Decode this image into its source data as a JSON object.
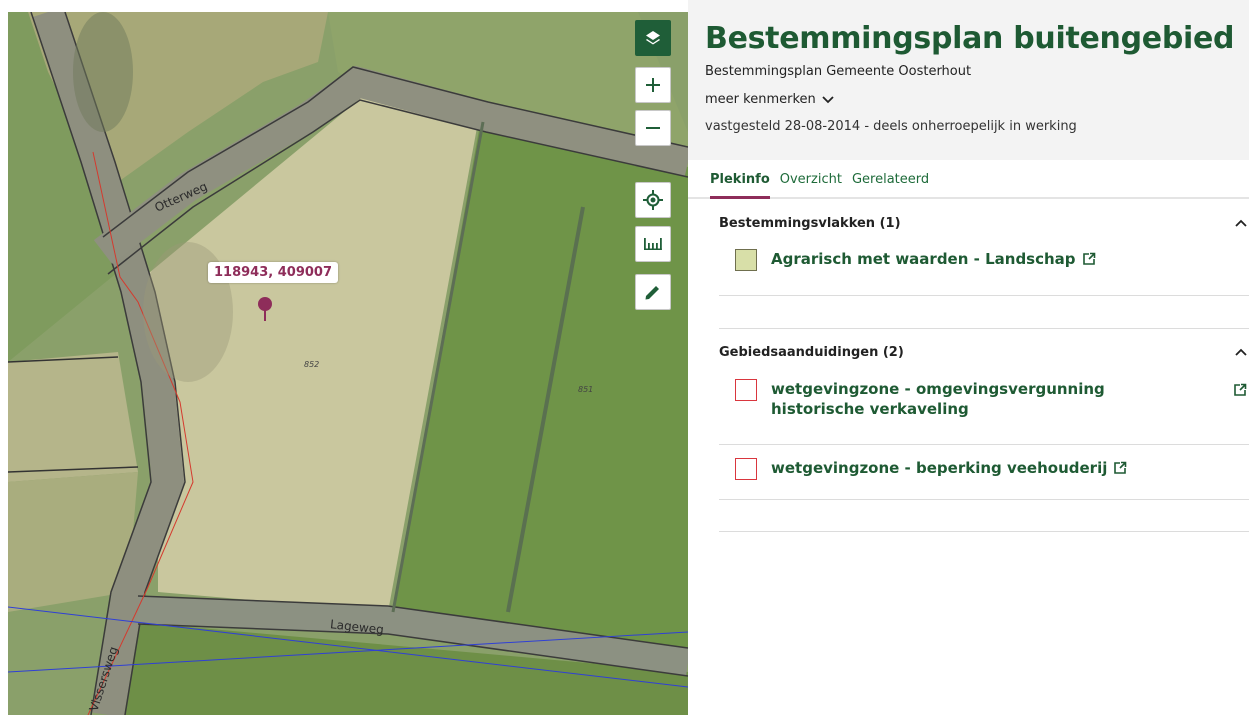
{
  "map": {
    "coordinate": "118943, 409007",
    "streets": {
      "otterweg": "Otterweg",
      "lageweg": "Lageweg",
      "vissersweg": "Vissersweg"
    },
    "parcels": {
      "left": "852",
      "right": "851"
    },
    "controls": [
      "layers-icon",
      "zoom-in-icon",
      "zoom-out-icon",
      "locate-icon",
      "measure-icon",
      "draw-icon"
    ],
    "accent": "#1f5e38"
  },
  "panel": {
    "title": "Bestemmingsplan buitengebied",
    "subtitle": "Bestemmingsplan  Gemeente Oosterhout",
    "more_label": "meer kenmerken",
    "status": "vastgesteld 28-08-2014 - deels onherroepelijk in werking",
    "tabs": [
      "Plekinfo",
      "Overzicht",
      "Gerelateerd"
    ],
    "sections": [
      {
        "heading": "Bestemmingsvlakken (1)",
        "items": [
          {
            "label": "Agrarisch met waarden - Landschap",
            "swatch": "#d8dfa8"
          }
        ]
      },
      {
        "heading": "Gebiedsaanduidingen (2)",
        "items": [
          {
            "label": "wetgevingzone - omgevingsvergunning historische verkaveling",
            "swatch": "#d9363e"
          },
          {
            "label": "wetgevingzone - beperking veehouderij",
            "swatch": "#d9363e"
          }
        ]
      }
    ],
    "colors": {
      "title": "#1e5a33",
      "tab_underline": "#8e2d5a"
    }
  }
}
